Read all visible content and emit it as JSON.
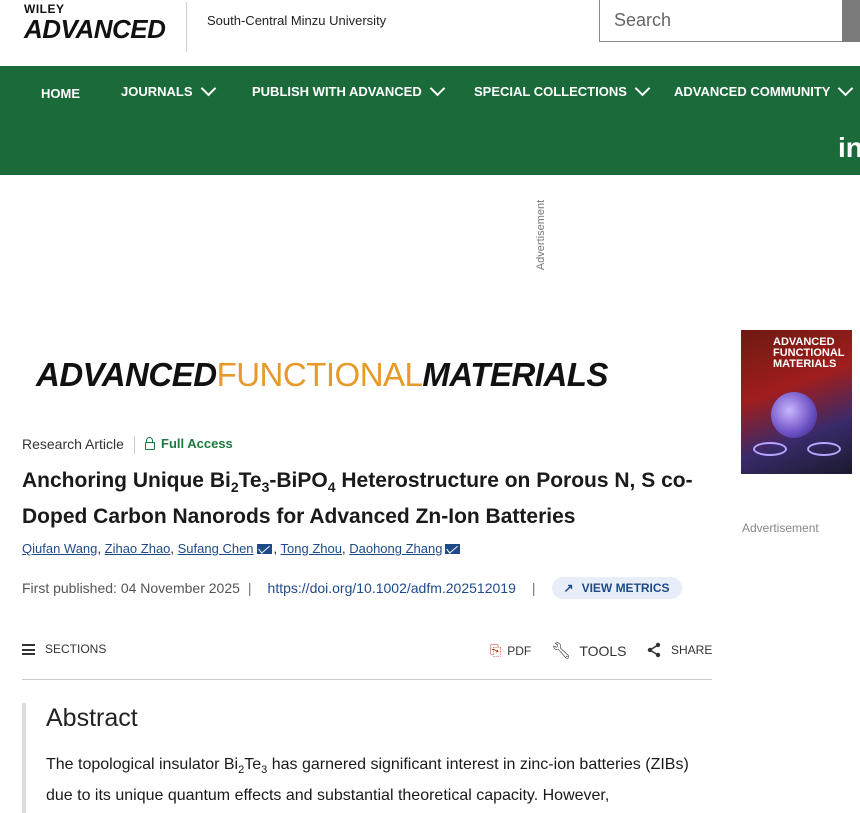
{
  "header": {
    "brand_top": "WILEY",
    "brand_main": "ADVANCED",
    "institution": "South-Central Minzu University",
    "search": {
      "placeholder": "Search"
    }
  },
  "nav": {
    "items": [
      {
        "label": "HOME"
      },
      {
        "label": "JOURNALS"
      },
      {
        "label": "PUBLISH WITH ADVANCED"
      },
      {
        "label": "SPECIAL COLLECTIONS"
      },
      {
        "label": "ADVANCED COMMUNITY"
      }
    ],
    "social": "in"
  },
  "advertisement": {
    "top_label": "Advertisement",
    "side_label": "Advertisement"
  },
  "journal": {
    "name_part1": "ADVANCED",
    "name_part2": "FUNCTIONAL",
    "name_part3": "MATERIALS",
    "cover_title": "ADVANCED FUNCTIONAL MATERIALS"
  },
  "article": {
    "type": "Research Article",
    "access": "Full Access",
    "title_html_parts": [
      "Anchoring Unique Bi",
      "2",
      "Te",
      "3",
      "-BiPO",
      "4",
      " Heterostructure on Porous N, S co-Doped Carbon Nanorods for Advanced Zn-Ion Batteries"
    ],
    "authors": [
      {
        "name": "Qiufan Wang",
        "corresponding": false
      },
      {
        "name": "Zihao Zhao",
        "corresponding": false
      },
      {
        "name": "Sufang Chen",
        "corresponding": true
      },
      {
        "name": "Tong Zhou",
        "corresponding": false
      },
      {
        "name": "Daohong Zhang",
        "corresponding": true
      }
    ],
    "first_published_label": "First published:",
    "first_published_date": "04 November 2025",
    "doi": "https://doi.org/10.1002/adfm.202512019",
    "view_metrics": "VIEW METRICS"
  },
  "toolbar": {
    "sections": "SECTIONS",
    "pdf": "PDF",
    "tools": "TOOLS",
    "share": "SHARE"
  },
  "abstract": {
    "heading": "Abstract",
    "text_parts": [
      "The topological insulator Bi",
      "2",
      "Te",
      "3",
      " has garnered significant interest in zinc-ion batteries (ZIBs) due to its unique quantum effects and substantial theoretical capacity. However,"
    ]
  }
}
